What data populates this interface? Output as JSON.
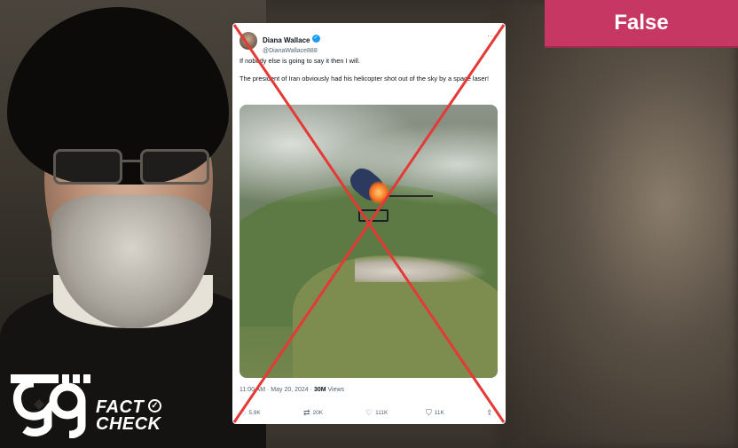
{
  "verdict": {
    "label": "False",
    "color": "#c73763"
  },
  "tweet": {
    "author_name": "Diana Wallace",
    "verified_icon": "verified-badge-icon",
    "handle": "@DianaWallace888",
    "more_label": "···",
    "text_lines": [
      "If nobody else is going to say it then I will.",
      "The president of Iran obviously had his helicopter shot out of the sky by a space laser!"
    ],
    "timestamp": "11:00 AM · May 20, 2024 ·",
    "views_count": "30M",
    "views_label": "Views",
    "actions": {
      "replies": "5.9K",
      "retweets": "20K",
      "likes": "111K",
      "bookmarks": "11K"
    }
  },
  "logo": {
    "name_text": "FACT\nCHECK",
    "line1": "FACT",
    "line2": "CHECK"
  },
  "overlay_color": "#e53935"
}
